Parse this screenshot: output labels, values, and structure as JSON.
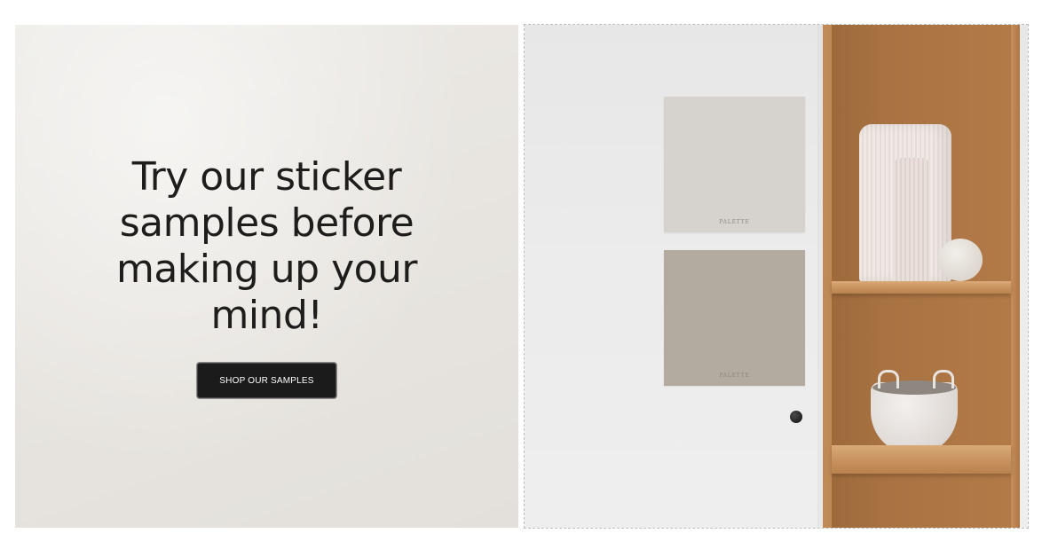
{
  "promo": {
    "headline_lines": [
      "Try our sticker",
      "samples before",
      "making up your",
      "mind!"
    ],
    "cta_label": "SHOP OUR SAMPLES"
  },
  "hero_image": {
    "swatches": [
      {
        "label": "PALETTE",
        "color": "#d6d3ce"
      },
      {
        "label": "PALETTE",
        "color": "#b3aba0"
      }
    ]
  },
  "colors": {
    "panel_background": "#e8e5e0",
    "button_background": "#1c1b1c",
    "button_text": "#ffffff",
    "headline_text": "#1f1d1b"
  }
}
